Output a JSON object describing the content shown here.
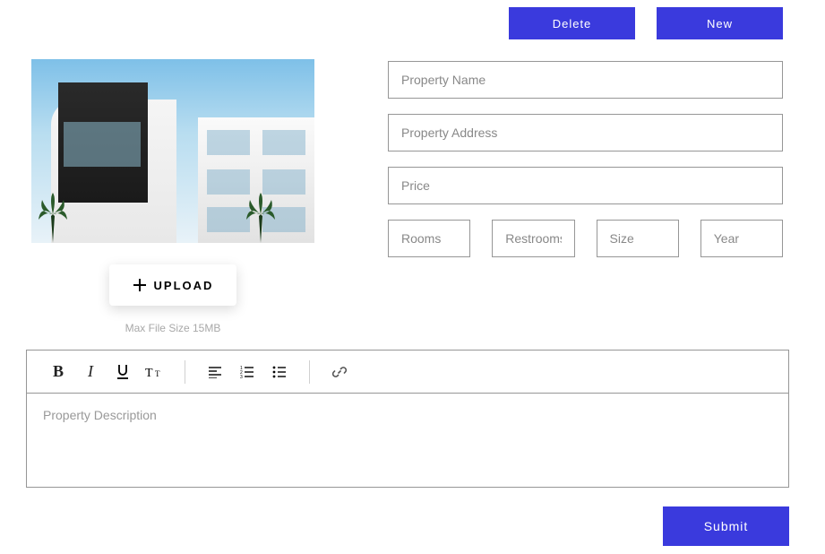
{
  "topButtons": {
    "delete": "Delete",
    "new": "New"
  },
  "upload": {
    "label": "UPLOAD",
    "hint": "Max File Size 15MB"
  },
  "fields": {
    "propertyName": "Property Name",
    "propertyAddress": "Property Address",
    "price": "Price",
    "rooms": "Rooms",
    "restrooms": "Restrooms",
    "size": "Size",
    "year": "Year"
  },
  "editor": {
    "placeholder": "Property Description"
  },
  "submit": "Submit"
}
